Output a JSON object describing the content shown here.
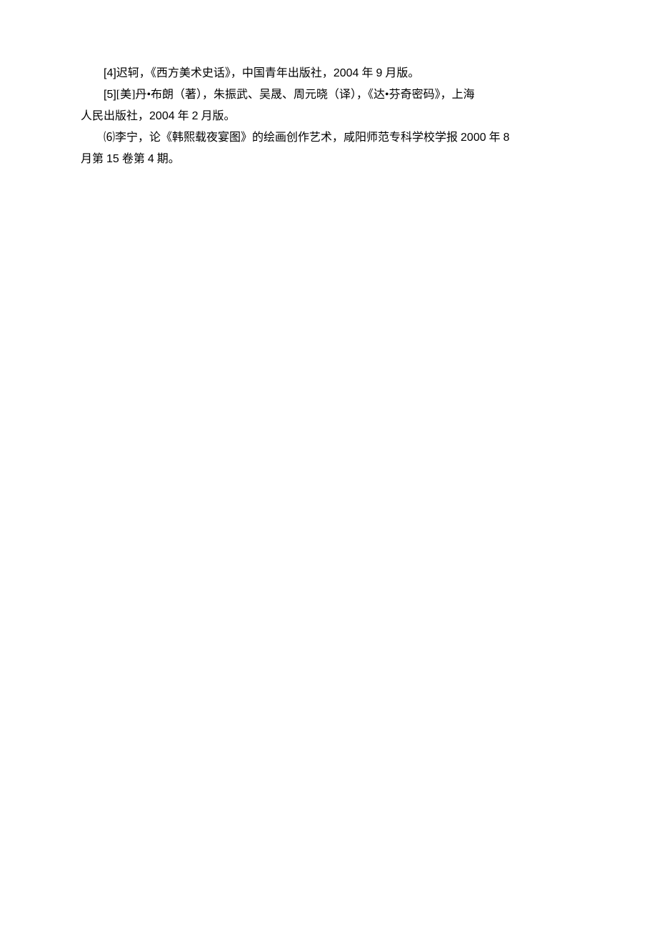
{
  "references": [
    {
      "citation_marker": "[4]",
      "author": "迟轲，",
      "title": "《西方美术史话》",
      "publisher": "，中国青年出版社，",
      "year": "2004",
      "year_suffix": " 年 ",
      "month": "9",
      "month_suffix": " 月版。"
    },
    {
      "citation_marker": "[5]",
      "author_prefix": "[美]丹•布朗（著），朱振武、吴晟、周元晓（译），《达•芬奇密码》，上海",
      "continuation": "人民出版社，",
      "year": "2004",
      "year_suffix": " 年 ",
      "month": "2",
      "month_suffix": " 月版。"
    },
    {
      "citation_marker": "⑹",
      "author": "李宁，论《韩熙载夜宴图》的绘画创作艺术，咸阳师范专科学校学报 ",
      "year": "2000",
      "year_suffix": " 年 ",
      "month": "8",
      "continuation_prefix": "月第 ",
      "volume": "15",
      "volume_suffix": " 卷第 ",
      "issue": "4",
      "issue_suffix": " 期。"
    }
  ]
}
